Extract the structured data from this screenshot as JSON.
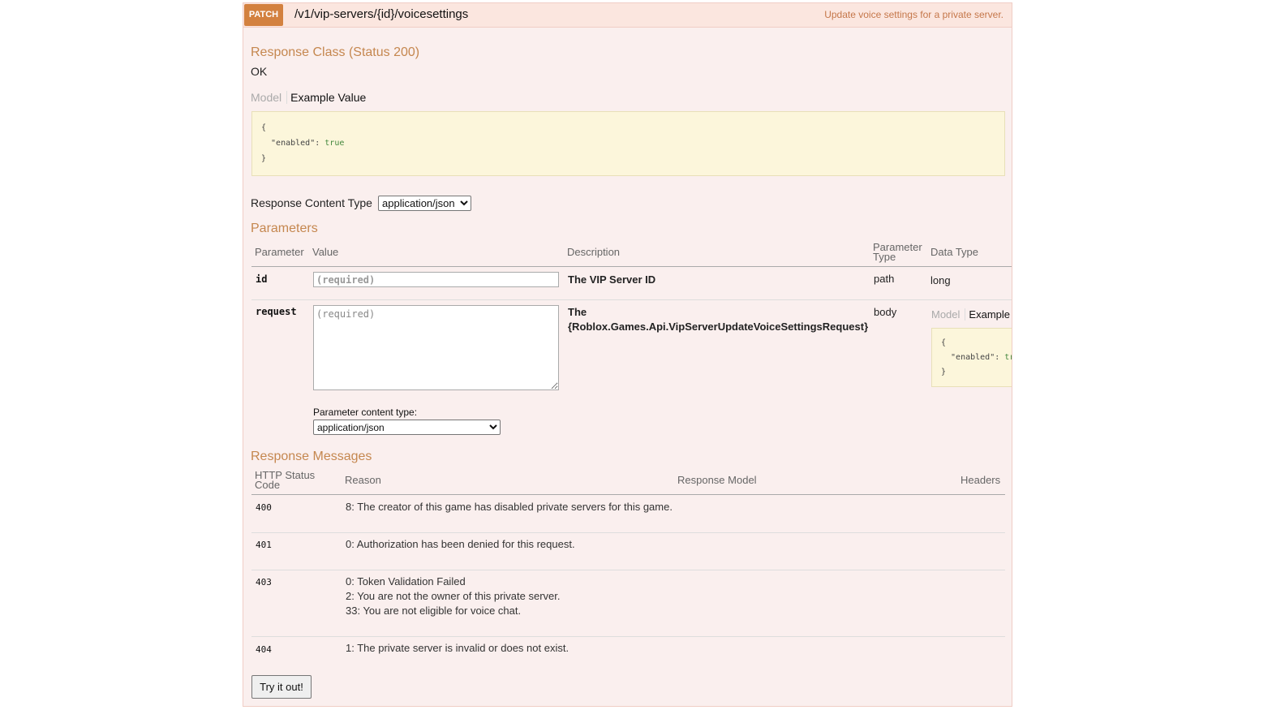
{
  "operation": {
    "method": "PATCH",
    "path": "/v1/vip-servers/{id}/voicesettings",
    "summary": "Update voice settings for a private server.",
    "accent_color": "#d3813f"
  },
  "response_class": {
    "heading": "Response Class (Status 200)",
    "status_text": "OK",
    "tab_model": "Model",
    "tab_example": "Example Value",
    "example_lines": [
      "{",
      "  \"enabled\": ",
      "}"
    ],
    "example_bool": "true"
  },
  "response_content_type": {
    "label": "Response Content Type",
    "selected": "application/json"
  },
  "parameters": {
    "heading": "Parameters",
    "columns": [
      "Parameter",
      "Value",
      "Description",
      "Parameter Type",
      "Data Type"
    ],
    "rows": [
      {
        "name": "id",
        "placeholder": "(required)",
        "description": "The VIP Server ID",
        "param_type": "path",
        "data_type": "long"
      },
      {
        "name": "request",
        "placeholder": "(required)",
        "description_line1": "The",
        "description_line2": "{Roblox.Games.Api.VipServerUpdateVoiceSettingsRequest}",
        "param_type": "body",
        "data_type_tab_model": "Model",
        "data_type_tab_example": "Example Value",
        "example_lines": [
          "{",
          "  \"enabled\": ",
          "}"
        ],
        "example_bool": "true"
      }
    ],
    "content_type_label": "Parameter content type:",
    "content_type_selected": "application/json"
  },
  "response_messages": {
    "heading": "Response Messages",
    "columns": [
      "HTTP Status Code",
      "Reason",
      "Response Model",
      "Headers"
    ],
    "rows": [
      {
        "code": "400",
        "reasons": [
          "8: The creator of this game has disabled private servers for this game."
        ]
      },
      {
        "code": "401",
        "reasons": [
          "0: Authorization has been denied for this request."
        ]
      },
      {
        "code": "403",
        "reasons": [
          "0: Token Validation Failed",
          "2: You are not the owner of this private server.",
          "33: You are not eligible for voice chat."
        ]
      },
      {
        "code": "404",
        "reasons": [
          "1: The private server is invalid or does not exist."
        ]
      }
    ]
  },
  "try_button": "Try it out!"
}
